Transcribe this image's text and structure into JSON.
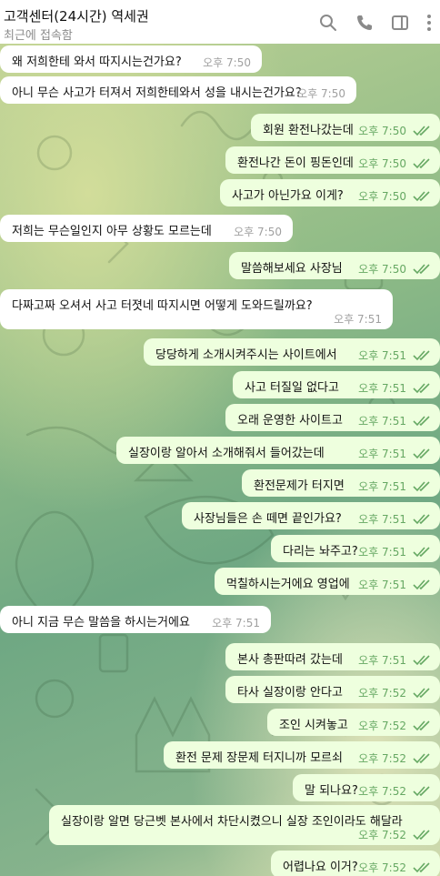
{
  "header": {
    "title": "고객센터(24시간) 역세권",
    "subtitle": "최근에 접속함",
    "icons": [
      "search-icon",
      "phone-icon",
      "sidebar-icon",
      "more-icon"
    ]
  },
  "colors": {
    "incoming_bubble": "#ffffff",
    "outgoing_bubble": "#eeffde",
    "outgoing_meta": "#66a863",
    "incoming_meta": "#a0a0a0"
  },
  "messages": [
    {
      "dir": "in",
      "text": "왜 저희한테 와서 따지시는건가요?",
      "time": "오후 7:50"
    },
    {
      "dir": "in",
      "text": "아니 무슨 사고가 터져서 저희한테와서 성을 내시는건가요?",
      "time": "오후 7:50"
    },
    {
      "dir": "out",
      "text": "회원 환전나갔는데",
      "time": "오후 7:50"
    },
    {
      "dir": "out",
      "text": "환전나간 돈이 핑돈인데",
      "time": "오후 7:50"
    },
    {
      "dir": "out",
      "text": "사고가 아닌가요 이게?",
      "time": "오후 7:50"
    },
    {
      "dir": "in",
      "text": "저희는 무슨일인지 아무 상황도 모르는데",
      "time": "오후 7:50"
    },
    {
      "dir": "out",
      "text": "말씀해보세요 사장님",
      "time": "오후 7:50"
    },
    {
      "dir": "in",
      "text": "다짜고짜 오셔서 사고 터졋네 따지시면 어떻게 도와드릴까요?",
      "time": "오후 7:51"
    },
    {
      "dir": "out",
      "text": "당당하게 소개시켜주시는 사이트에서",
      "time": "오후 7:51"
    },
    {
      "dir": "out",
      "text": "사고 터질일 없다고",
      "time": "오후 7:51"
    },
    {
      "dir": "out",
      "text": "오래 운영한 사이트고",
      "time": "오후 7:51"
    },
    {
      "dir": "out",
      "text": "실장이랑 알아서 소개해줘서 들어갔는데",
      "time": "오후 7:51"
    },
    {
      "dir": "out",
      "text": "환전문제가 터지면",
      "time": "오후 7:51"
    },
    {
      "dir": "out",
      "text": "사장님들은 손 떼면 끝인가요?",
      "time": "오후 7:51"
    },
    {
      "dir": "out",
      "text": "다리는 놔주고?",
      "time": "오후 7:51"
    },
    {
      "dir": "out",
      "text": "먹칠하시는거에요 영업에",
      "time": "오후 7:51"
    },
    {
      "dir": "in",
      "text": "아니 지금 무슨 말씀을 하시는거에요",
      "time": "오후 7:51"
    },
    {
      "dir": "out",
      "text": "본사 총판따려 갔는데",
      "time": "오후 7:51"
    },
    {
      "dir": "out",
      "text": "타사 실장이랑 안다고",
      "time": "오후 7:52"
    },
    {
      "dir": "out",
      "text": "조인 시켜놓고",
      "time": "오후 7:52"
    },
    {
      "dir": "out",
      "text": "환전 문제 장문제 터지니까 모르쇠",
      "time": "오후 7:52"
    },
    {
      "dir": "out",
      "text": "말 되나요?",
      "time": "오후 7:52"
    },
    {
      "dir": "out",
      "text": "실장이랑 알면 당근벳 본사에서 차단시켰으니 실장 조인이라도 해달라",
      "time": "오후 7:52"
    },
    {
      "dir": "out",
      "text": "어렵나요 이거?",
      "time": "오후 7:52"
    }
  ]
}
